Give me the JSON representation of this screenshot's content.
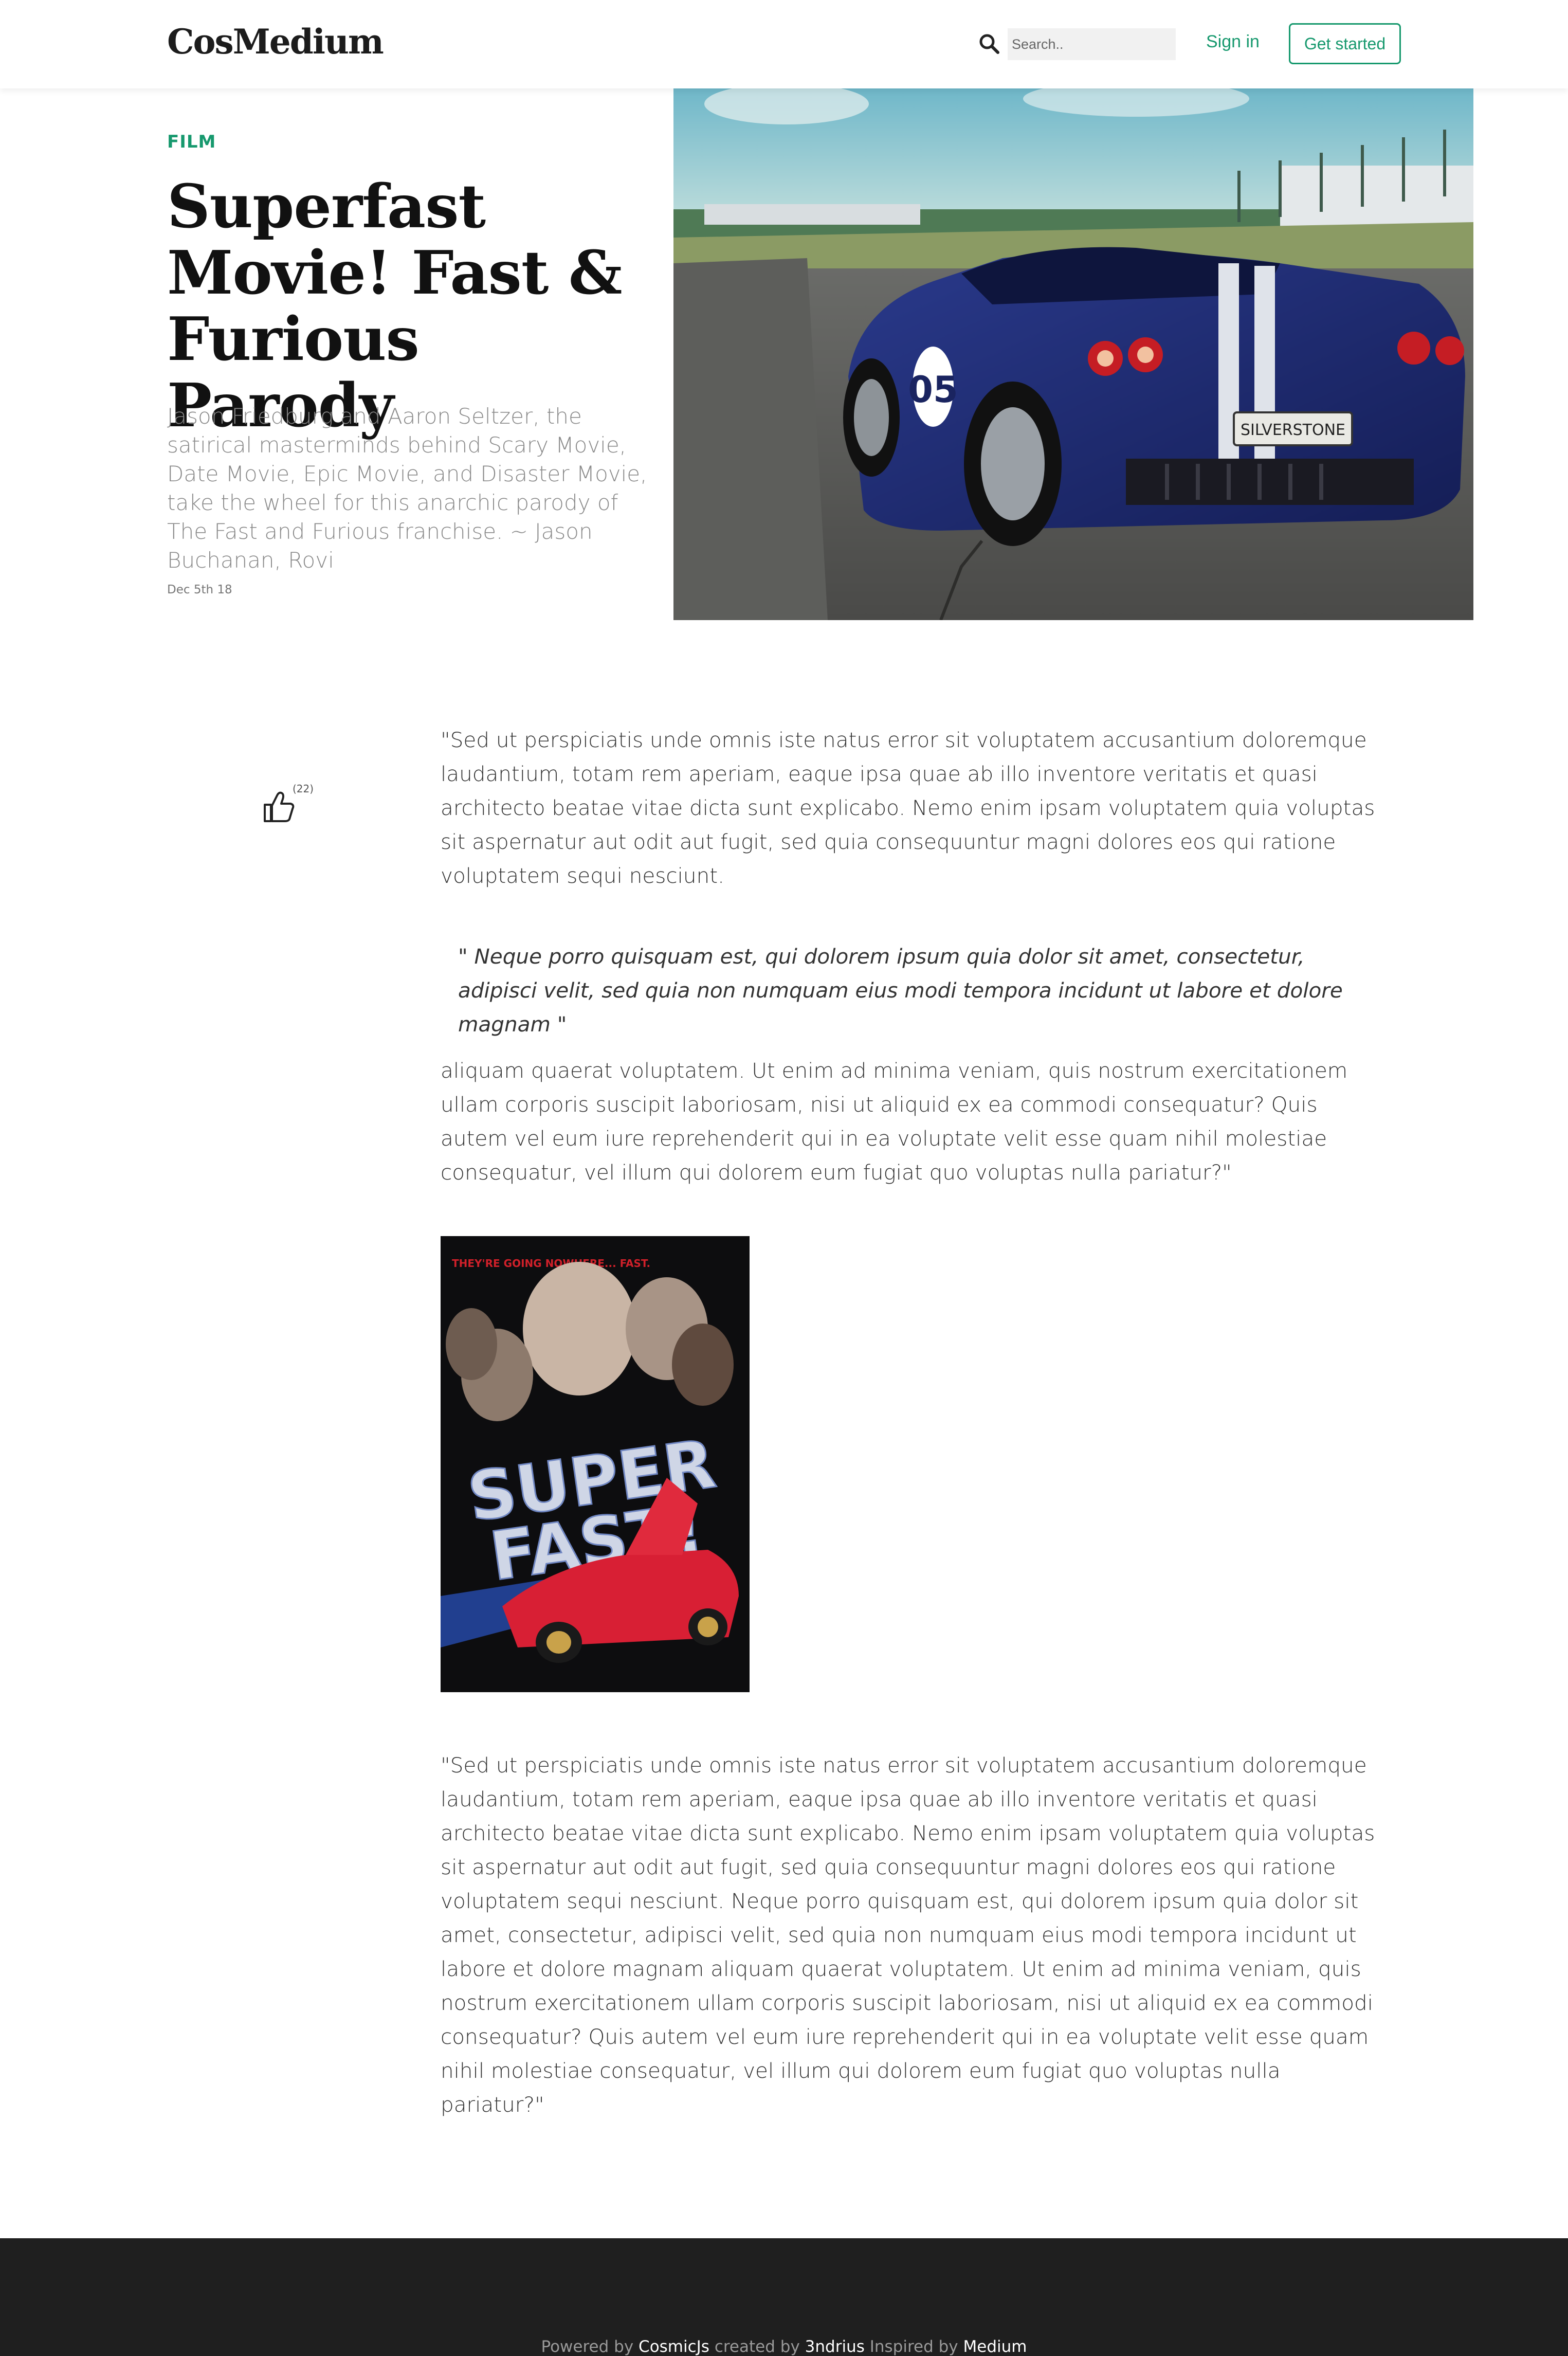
{
  "header": {
    "brand": "CosMedium",
    "search_placeholder": "Search..",
    "signin_label": "Sign in",
    "getstarted_label": "Get started"
  },
  "article": {
    "category": "FILM",
    "title": "Superfast Movie! Fast & Furious Parody",
    "subtitle": "Jason Friedburg and Aaron Seltzer, the satirical masterminds behind Scary Movie, Date Movie, Epic Movie, and Disaster Movie, take the wheel for this anarchic parody of The Fast and Furious franchise. ~ Jason Buchanan, Rovi",
    "date": "Dec 5th 18",
    "like_count": "(22)",
    "paragraph_1": "\"Sed ut perspiciatis unde omnis iste natus error sit voluptatem accusantium doloremque laudantium, totam rem aperiam, eaque ipsa quae ab illo inventore veritatis et quasi architecto beatae vitae dicta sunt explicabo. Nemo enim ipsam voluptatem quia voluptas sit aspernatur aut odit aut fugit, sed quia consequuntur magni dolores eos qui ratione voluptatem sequi nesciunt.",
    "quote": "\" Neque porro quisquam est, qui dolorem ipsum quia dolor sit amet, consectetur, adipisci velit, sed quia non numquam eius modi tempora incidunt ut labore et dolore magnam \"",
    "paragraph_2": "aliquam quaerat voluptatem. Ut enim ad minima veniam, quis nostrum exercitationem ullam corporis suscipit laboriosam, nisi ut aliquid ex ea commodi consequatur? Quis autem vel eum iure reprehenderit qui in ea voluptate velit esse quam nihil molestiae consequatur, vel illum qui dolorem eum fugiat quo voluptas nulla pariatur?\"",
    "paragraph_3": "\"Sed ut perspiciatis unde omnis iste natus error sit voluptatem accusantium doloremque laudantium, totam rem aperiam, eaque ipsa quae ab illo inventore veritatis et quasi architecto beatae vitae dicta sunt explicabo. Nemo enim ipsam voluptatem quia voluptas sit aspernatur aut odit aut fugit, sed quia consequuntur magni dolores eos qui ratione voluptatem sequi nesciunt. Neque porro quisquam est, qui dolorem ipsum quia dolor sit amet, consectetur, adipisci velit, sed quia non numquam eius modi tempora incidunt ut labore et dolore magnam aliquam quaerat voluptatem. Ut enim ad minima veniam, quis nostrum exercitationem ullam corporis suscipit laboriosam, nisi ut aliquid ex ea commodi consequatur? Quis autem vel eum iure reprehenderit qui in ea voluptate velit esse quam nihil molestiae consequatur, vel illum qui dolorem eum fugiat quo voluptas nulla pariatur?\"",
    "hero_image": {
      "plate_text": "SILVERSTONE",
      "car_number": "05"
    },
    "poster_image": {
      "tagline": "THEY'RE GOING NOWHERE... FAST.",
      "title_line_1": "SUPER",
      "title_line_2": "FAST!"
    }
  },
  "footer": {
    "powered_by": "Powered by",
    "cosmicjs": "CosmicJs",
    "created_by": "created by",
    "author": "3ndrius",
    "inspired_by": "Inspired by",
    "medium": "Medium"
  },
  "colors": {
    "accent": "#17996e",
    "footer_bg": "#1f1f1f",
    "title": "#111111"
  },
  "icons": {
    "search": "search-icon",
    "like": "thumbs-up-icon"
  }
}
